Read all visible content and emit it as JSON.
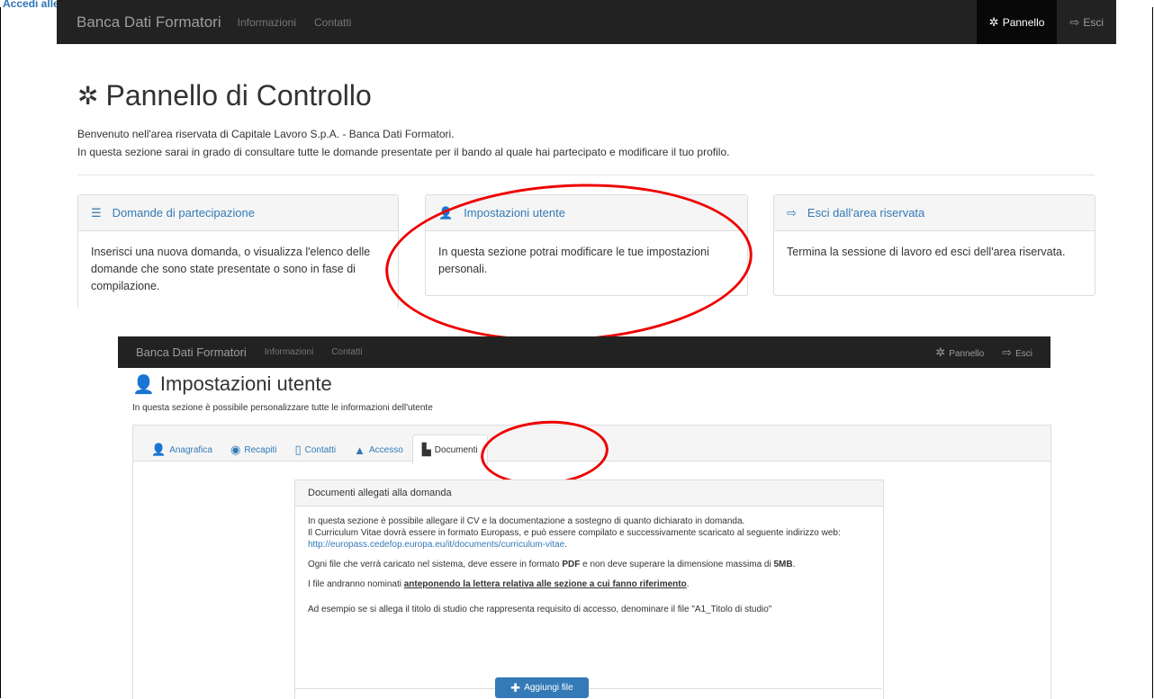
{
  "doc_title": "Accedi alle Impostazioni utente",
  "nav1": {
    "brand": "Banca Dati Formatori",
    "links": [
      "Informazioni",
      "Contatti"
    ],
    "pannello": "Pannello",
    "esci": "Esci"
  },
  "panel": {
    "title": "Pannello di Controllo",
    "intro1": "Benvenuto nell'area riservata di Capitale Lavoro S.p.A. - Banca Dati Formatori.",
    "intro2": "In questa sezione sarai in grado di consultare tutte le domande presentate per il bando al quale hai partecipato e modificare il tuo profilo."
  },
  "cards": [
    {
      "title": "Domande di partecipazione",
      "body": "Inserisci una nuova domanda, o visualizza l'elenco delle domande che sono state presentate o sono in fase di compilazione.",
      "icon": "list-icon"
    },
    {
      "title": "Impostazioni utente",
      "body": "In questa sezione potrai modificare le tue impostazioni personali.",
      "icon": "user-icon"
    },
    {
      "title": "Esci dall'area riservata",
      "body": "Termina la sessione di lavoro ed esci dell'area riservata.",
      "icon": "logout-icon"
    }
  ],
  "nav2": {
    "brand": "Banca Dati Formatori",
    "links": [
      "Informazioni",
      "Contatti"
    ],
    "pannello": "Pannello",
    "esci": "Esci"
  },
  "settings": {
    "title": "Impostazioni utente",
    "subtitle": "In questa sezione è possibile personalizzare tutte le informazioni dell'utente",
    "tabs": [
      "Anagrafica",
      "Recapiti",
      "Contatti",
      "Accesso",
      "Documenti"
    ]
  },
  "documents": {
    "header": "Documenti allegati alla domanda",
    "p1": "In questa sezione è possibile allegare il CV e la documentazione a sostegno di quanto dichiarato in domanda.",
    "p2": "Il Curriculum Vitae dovrà essere in formato Europass, e può essere compilato e successivamente scaricato al seguente indirizzo web:",
    "link": "http://europass.cedefop.europa.eu/it/documents/curriculum-vitae",
    "p3a": "Ogni file che verrà caricato nel sistema, deve essere in formato ",
    "p3b": "PDF",
    "p3c": " e non deve superare la dimensione massima di ",
    "p3d": "5MB",
    "p4a": "I file andranno nominati ",
    "p4b": "anteponendo la lettera relativa alle sezione a cui fanno riferimento",
    "p5": "Ad esempio se si allega il titolo di studio che rappresenta requisito di accesso, denominare il file \"A1_Titolo di studio\"",
    "button": "Aggiungi file"
  },
  "colors": {
    "navbar": "#222222",
    "accent": "#337ab7",
    "highlight": "#ee0000"
  }
}
